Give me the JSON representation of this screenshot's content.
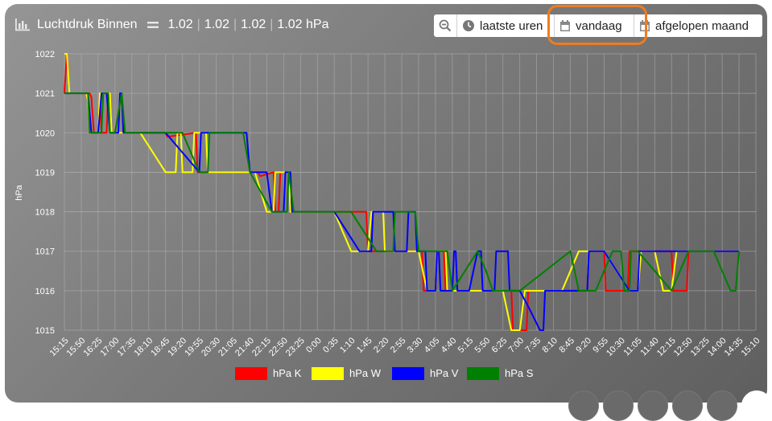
{
  "header": {
    "title": "Luchtdruk Binnen",
    "values": [
      "1.02",
      "1.02",
      "1.02",
      "1.02 hPa"
    ]
  },
  "toolbar": {
    "last_hours": "laatste uren",
    "today": "vandaag",
    "last_month": "afgelopen maand"
  },
  "chart_data": {
    "type": "line",
    "ylabel": "hPa",
    "ylim": [
      1015,
      1022
    ],
    "yticks": [
      1015,
      1016,
      1017,
      1018,
      1019,
      1020,
      1021,
      1022
    ],
    "xticks": [
      "15:15",
      "15:50",
      "16:25",
      "17:00",
      "17:35",
      "18:10",
      "18:45",
      "19:20",
      "19:55",
      "20:30",
      "21:05",
      "21:40",
      "22:15",
      "22:50",
      "23:25",
      "0:00",
      "0:35",
      "1:10",
      "1:45",
      "2:20",
      "2:55",
      "3:30",
      "4:05",
      "4:40",
      "5:15",
      "5:50",
      "6:25",
      "7:00",
      "7:35",
      "8:10",
      "8:45",
      "9:20",
      "9:55",
      "10:30",
      "11:05",
      "11:40",
      "12:15",
      "12:50",
      "13:25",
      "14:00",
      "14:35",
      "15:10"
    ],
    "grid": true,
    "legend": "bottom",
    "series": [
      {
        "name": "hPa K",
        "color": "#ff0000",
        "points": [
          [
            0,
            1021
          ],
          [
            0.15,
            1022
          ],
          [
            0.3,
            1021
          ],
          [
            1.5,
            1021
          ],
          [
            1.6,
            1020.9
          ],
          [
            1.75,
            1020
          ],
          [
            2.0,
            1020
          ],
          [
            2.1,
            1021
          ],
          [
            2.2,
            1020
          ],
          [
            2.5,
            1020
          ],
          [
            2.6,
            1021
          ],
          [
            2.7,
            1021
          ],
          [
            2.8,
            1020
          ],
          [
            3.0,
            1020
          ],
          [
            3.4,
            1021
          ],
          [
            3.5,
            1020
          ],
          [
            4.2,
            1020
          ],
          [
            5.8,
            1020
          ],
          [
            6.0,
            1020
          ],
          [
            6.1,
            1019.9
          ],
          [
            7.8,
            1020
          ],
          [
            7.9,
            1019
          ],
          [
            8.0,
            1019
          ],
          [
            9.0,
            1019
          ],
          [
            11.0,
            1019
          ],
          [
            11.5,
            1019
          ],
          [
            11.6,
            1018.9
          ],
          [
            12.4,
            1019
          ],
          [
            12.5,
            1018
          ],
          [
            12.7,
            1018
          ],
          [
            12.8,
            1019
          ],
          [
            13.4,
            1019
          ],
          [
            13.5,
            1018
          ],
          [
            17.9,
            1018
          ],
          [
            18.0,
            1017
          ],
          [
            19.0,
            1017
          ],
          [
            21.2,
            1017
          ],
          [
            21.3,
            1016
          ],
          [
            22.0,
            1016
          ],
          [
            22.1,
            1017
          ],
          [
            22.5,
            1017
          ],
          [
            22.6,
            1016
          ],
          [
            26.5,
            1016
          ],
          [
            26.6,
            1015
          ],
          [
            27.4,
            1015
          ],
          [
            27.5,
            1016
          ],
          [
            28.0,
            1016
          ],
          [
            29.5,
            1016
          ],
          [
            31.0,
            1016
          ],
          [
            31.1,
            1017
          ],
          [
            32.0,
            1017
          ],
          [
            32.1,
            1016
          ],
          [
            33.4,
            1016
          ],
          [
            33.5,
            1017
          ],
          [
            35.0,
            1017
          ],
          [
            36.0,
            1017
          ],
          [
            36.1,
            1016
          ],
          [
            36.9,
            1016
          ],
          [
            37.0,
            1017
          ],
          [
            38.0,
            1017
          ],
          [
            40.0,
            1017
          ]
        ]
      },
      {
        "name": "hPa W",
        "color": "#ffff00",
        "points": [
          [
            0,
            1022
          ],
          [
            0.15,
            1022
          ],
          [
            0.3,
            1021
          ],
          [
            1.2,
            1021
          ],
          [
            1.3,
            1021
          ],
          [
            1.4,
            1020.8
          ],
          [
            1.5,
            1020
          ],
          [
            1.8,
            1020
          ],
          [
            2.0,
            1020
          ],
          [
            2.1,
            1021
          ],
          [
            2.7,
            1021
          ],
          [
            2.8,
            1020
          ],
          [
            3.0,
            1020
          ],
          [
            3.5,
            1020
          ],
          [
            4.5,
            1020
          ],
          [
            6.0,
            1019
          ],
          [
            6.6,
            1019
          ],
          [
            6.7,
            1020
          ],
          [
            6.9,
            1020
          ],
          [
            7.0,
            1019
          ],
          [
            7.6,
            1019
          ],
          [
            7.7,
            1020
          ],
          [
            8.4,
            1020
          ],
          [
            8.5,
            1019
          ],
          [
            10.5,
            1019
          ],
          [
            11.3,
            1019
          ],
          [
            12.0,
            1018
          ],
          [
            12.4,
            1018
          ],
          [
            12.5,
            1019
          ],
          [
            13.3,
            1019
          ],
          [
            13.4,
            1018
          ],
          [
            15.0,
            1018
          ],
          [
            16.0,
            1018
          ],
          [
            17.0,
            1017
          ],
          [
            18.0,
            1017
          ],
          [
            18.2,
            1018
          ],
          [
            18.9,
            1018
          ],
          [
            19.0,
            1017
          ],
          [
            21.0,
            1017
          ],
          [
            21.5,
            1016
          ],
          [
            22.0,
            1016
          ],
          [
            22.1,
            1017
          ],
          [
            22.6,
            1017
          ],
          [
            22.7,
            1016
          ],
          [
            25.0,
            1016
          ],
          [
            26.0,
            1016
          ],
          [
            26.5,
            1015
          ],
          [
            27.0,
            1015
          ],
          [
            27.3,
            1016
          ],
          [
            28.0,
            1016
          ],
          [
            29.5,
            1016
          ],
          [
            30.5,
            1017
          ],
          [
            32.0,
            1017
          ],
          [
            33.5,
            1016
          ],
          [
            34.0,
            1016
          ],
          [
            34.2,
            1017
          ],
          [
            35.0,
            1017
          ],
          [
            35.5,
            1016
          ],
          [
            36.0,
            1016
          ],
          [
            36.3,
            1017
          ],
          [
            40.0,
            1017
          ]
        ]
      },
      {
        "name": "hPa V",
        "color": "#0000ff",
        "points": [
          [
            0,
            1021
          ],
          [
            0.3,
            1021
          ],
          [
            1.4,
            1021
          ],
          [
            1.6,
            1020
          ],
          [
            2.0,
            1020
          ],
          [
            2.2,
            1021
          ],
          [
            2.5,
            1021
          ],
          [
            2.7,
            1020
          ],
          [
            3.0,
            1020
          ],
          [
            3.2,
            1020
          ],
          [
            3.3,
            1021
          ],
          [
            3.4,
            1021
          ],
          [
            3.5,
            1020
          ],
          [
            5.0,
            1020
          ],
          [
            6.0,
            1020
          ],
          [
            8.0,
            1019
          ],
          [
            8.1,
            1020
          ],
          [
            9.0,
            1020
          ],
          [
            10.8,
            1020
          ],
          [
            11.0,
            1019
          ],
          [
            12.0,
            1019
          ],
          [
            12.3,
            1018
          ],
          [
            12.4,
            1018
          ],
          [
            13.0,
            1018
          ],
          [
            13.1,
            1019
          ],
          [
            13.4,
            1019
          ],
          [
            13.5,
            1018
          ],
          [
            16.0,
            1018
          ],
          [
            17.5,
            1017
          ],
          [
            18.2,
            1017
          ],
          [
            18.3,
            1018
          ],
          [
            19.0,
            1018
          ],
          [
            19.5,
            1018
          ],
          [
            19.6,
            1017
          ],
          [
            20.3,
            1017
          ],
          [
            20.4,
            1018
          ],
          [
            20.8,
            1018
          ],
          [
            20.9,
            1017
          ],
          [
            21.4,
            1017
          ],
          [
            21.5,
            1016
          ],
          [
            22.0,
            1016
          ],
          [
            22.1,
            1017
          ],
          [
            22.2,
            1017
          ],
          [
            22.3,
            1016
          ],
          [
            23.0,
            1016
          ],
          [
            23.1,
            1017
          ],
          [
            23.2,
            1017
          ],
          [
            23.3,
            1016
          ],
          [
            24.0,
            1016
          ],
          [
            24.5,
            1017
          ],
          [
            24.7,
            1017
          ],
          [
            24.8,
            1016
          ],
          [
            25.5,
            1016
          ],
          [
            25.6,
            1017
          ],
          [
            26.3,
            1017
          ],
          [
            26.4,
            1016
          ],
          [
            27.0,
            1016
          ],
          [
            27.5,
            1015.6
          ],
          [
            28.2,
            1015
          ],
          [
            28.4,
            1015
          ],
          [
            28.5,
            1016
          ],
          [
            30.5,
            1016
          ],
          [
            31.0,
            1016
          ],
          [
            31.1,
            1017
          ],
          [
            32.0,
            1017
          ],
          [
            33.5,
            1016
          ],
          [
            34.0,
            1016
          ],
          [
            34.1,
            1017
          ],
          [
            35.0,
            1017
          ],
          [
            36.0,
            1017
          ],
          [
            37.0,
            1017
          ],
          [
            40.0,
            1017
          ]
        ]
      },
      {
        "name": "hPa S",
        "color": "#008000",
        "points": [
          [
            0,
            1021
          ],
          [
            0.3,
            1021
          ],
          [
            1.4,
            1021
          ],
          [
            1.5,
            1020
          ],
          [
            2.2,
            1020
          ],
          [
            2.3,
            1021
          ],
          [
            2.6,
            1021
          ],
          [
            2.7,
            1020
          ],
          [
            3.0,
            1020
          ],
          [
            3.4,
            1021
          ],
          [
            3.6,
            1020
          ],
          [
            5.0,
            1020
          ],
          [
            7.0,
            1020
          ],
          [
            8.0,
            1019
          ],
          [
            8.5,
            1019
          ],
          [
            8.6,
            1020
          ],
          [
            10.6,
            1020
          ],
          [
            11.0,
            1019
          ],
          [
            12.3,
            1018
          ],
          [
            13.2,
            1018
          ],
          [
            13.3,
            1019
          ],
          [
            13.6,
            1018
          ],
          [
            16.0,
            1018
          ],
          [
            17.0,
            1018
          ],
          [
            18.5,
            1017
          ],
          [
            19.5,
            1017
          ],
          [
            19.6,
            1018
          ],
          [
            20.8,
            1018
          ],
          [
            21.0,
            1017
          ],
          [
            22.0,
            1017
          ],
          [
            22.7,
            1017
          ],
          [
            23.0,
            1016
          ],
          [
            24.5,
            1017
          ],
          [
            25.0,
            1016.5
          ],
          [
            25.4,
            1016
          ],
          [
            26.5,
            1016
          ],
          [
            27.0,
            1016
          ],
          [
            30.0,
            1017
          ],
          [
            30.5,
            1016
          ],
          [
            31.5,
            1016
          ],
          [
            32.5,
            1017
          ],
          [
            33.0,
            1017
          ],
          [
            33.2,
            1016
          ],
          [
            33.5,
            1016
          ],
          [
            33.6,
            1017
          ],
          [
            34.0,
            1017
          ],
          [
            36.0,
            1016
          ],
          [
            37.0,
            1017
          ],
          [
            38.5,
            1017
          ],
          [
            39.5,
            1016
          ],
          [
            39.8,
            1016
          ],
          [
            40.0,
            1017
          ]
        ]
      }
    ]
  }
}
